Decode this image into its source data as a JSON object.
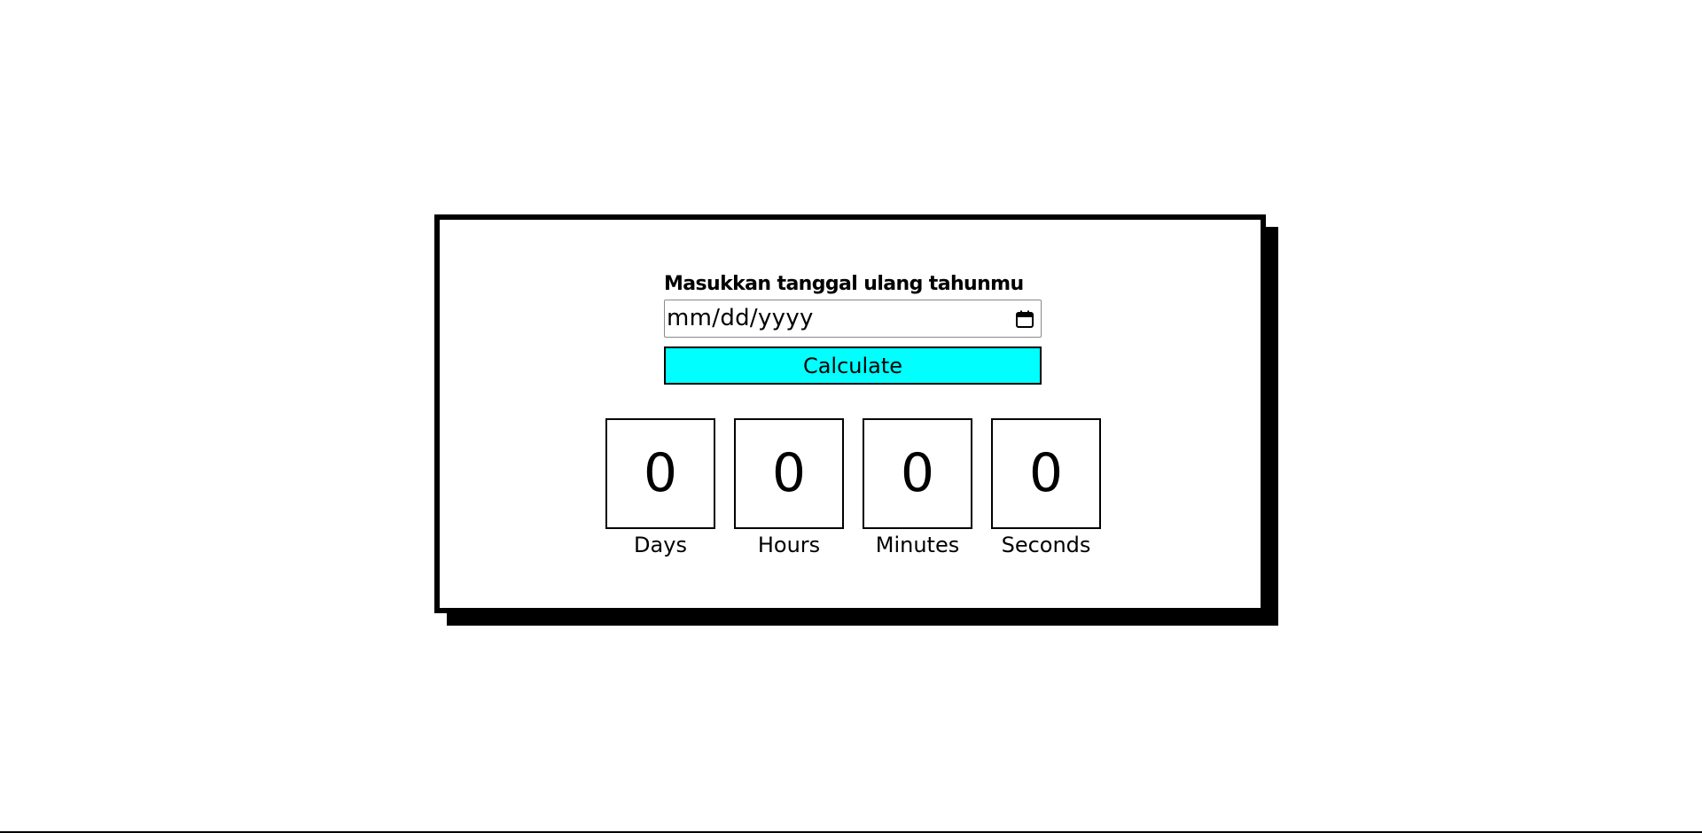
{
  "form": {
    "label": "Masukkan tanggal ulang tahunmu",
    "date_placeholder": "mm/dd/yyyy",
    "calendar_icon": "calendar-icon",
    "button_label": "Calculate",
    "button_color": "#00ffff"
  },
  "countdown": [
    {
      "value": "0",
      "label": "Days"
    },
    {
      "value": "0",
      "label": "Hours"
    },
    {
      "value": "0",
      "label": "Minutes"
    },
    {
      "value": "0",
      "label": "Seconds"
    }
  ]
}
